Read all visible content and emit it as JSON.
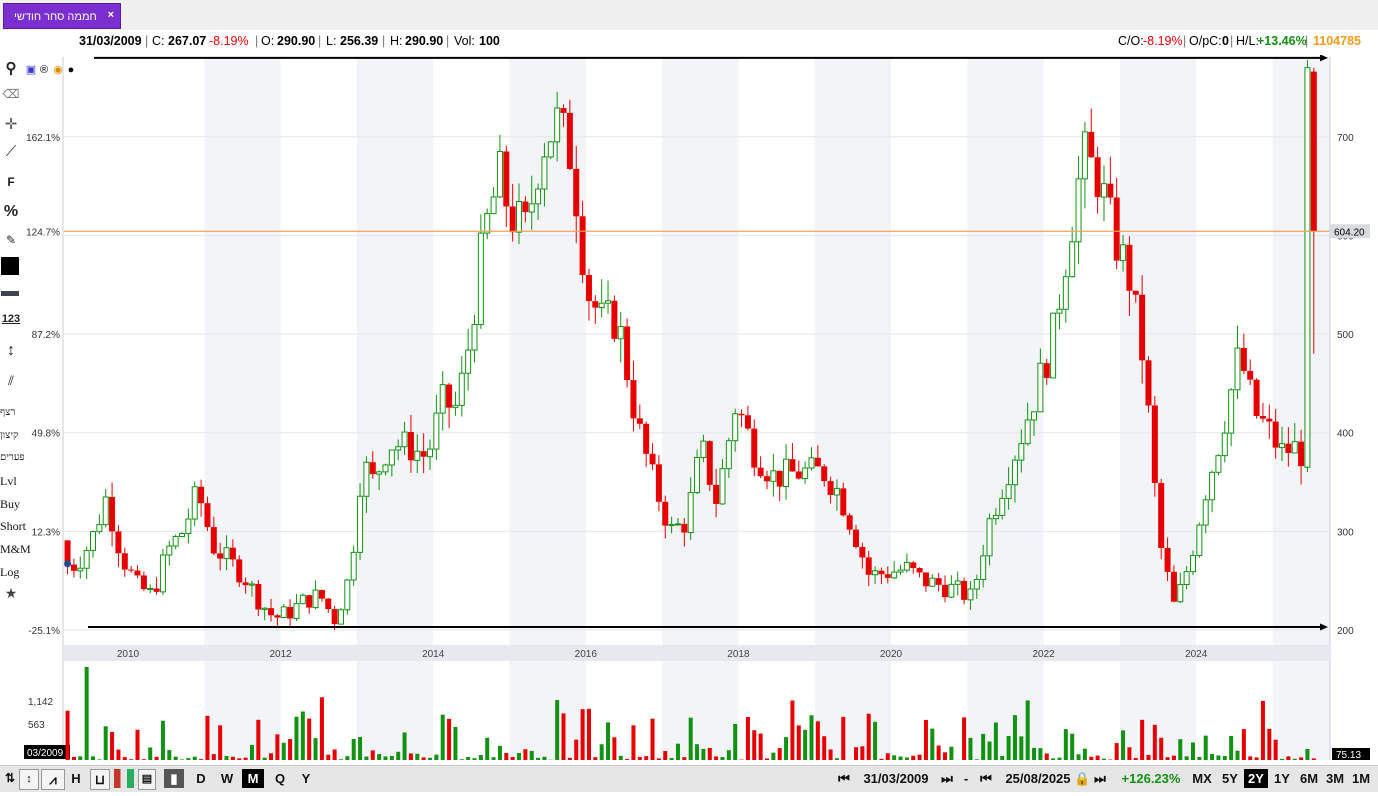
{
  "tab": {
    "label": "חממה סחר חודשי",
    "close": "×"
  },
  "info": {
    "date": "31/03/2009",
    "close_label": "C:",
    "close_value": "267.07",
    "change_pct": "-8.19%",
    "open_label": "O:",
    "open_value": "290.90",
    "low_label": "L:",
    "low_value": "256.39",
    "high_label": "H:",
    "high_value": "290.90",
    "vol_label": "Vol:",
    "vol_value": "100",
    "co_label": "C/O:",
    "co_value": "-8.19%",
    "opc_label": "O/pC:",
    "opc_value": "0",
    "hl_label": "H/L:",
    "hl_value": "+13.46%",
    "id_value": "1104785"
  },
  "left_toolbar": {
    "items_text": [
      "F",
      "%",
      "123"
    ],
    "hebrew_items": [
      "רצף",
      "קיצון",
      "פערים"
    ],
    "labels": [
      "Lvl",
      "Buy",
      "Short",
      "M&M",
      "Log"
    ]
  },
  "bottom": {
    "chart_types": [
      "D",
      "W",
      "M",
      "Q",
      "Y"
    ],
    "selected_type": "M",
    "start_date": "31/03/2009",
    "end_date": "25/08/2025",
    "range_change": "+126.23%",
    "ranges": [
      "MX",
      "5Y",
      "2Y",
      "1Y",
      "6M",
      "3M",
      "1M"
    ],
    "selected_range": "2Y",
    "dash": "-",
    "h_label": "H"
  },
  "colors": {
    "up": "#129212",
    "down": "#e60000",
    "accent": "#7b2fd0",
    "hline": "#f2a35c"
  },
  "chart_data": {
    "type": "candlestick",
    "price_axis": {
      "min": 200,
      "max": 780,
      "ticks": [
        200,
        300,
        400,
        500,
        600,
        700
      ]
    },
    "pct_axis": {
      "labels": [
        "162.1%",
        "124.7%",
        "87.2%",
        "49.8%",
        "12.3%",
        "-25.1%"
      ],
      "values": [
        700,
        604.2,
        500,
        400,
        300,
        200
      ]
    },
    "x_axis": {
      "labels": [
        "2010",
        "2012",
        "2014",
        "2016",
        "2018",
        "2020",
        "2022",
        "2024"
      ],
      "start": 2009.2,
      "end": 2025.65
    },
    "last_price_label": "604.20",
    "horizontal_line": 604.2,
    "top_line": 780,
    "bottom_line": 203,
    "volume_axis": {
      "labels": [
        "1,142",
        "563"
      ],
      "max": 1560
    },
    "volume_left_label": "03/2009",
    "volume_right_label": "75.13",
    "anchors": [
      [
        2009.2,
        267
      ],
      [
        2009.4,
        266
      ],
      [
        2009.6,
        290
      ],
      [
        2009.8,
        335
      ],
      [
        2010.0,
        275
      ],
      [
        2010.2,
        245
      ],
      [
        2010.4,
        235
      ],
      [
        2010.6,
        280
      ],
      [
        2010.8,
        300
      ],
      [
        2011.0,
        340
      ],
      [
        2011.2,
        285
      ],
      [
        2011.4,
        270
      ],
      [
        2011.6,
        255
      ],
      [
        2011.8,
        230
      ],
      [
        2012.0,
        212
      ],
      [
        2012.2,
        218
      ],
      [
        2012.4,
        230
      ],
      [
        2012.6,
        235
      ],
      [
        2012.8,
        210
      ],
      [
        2013.0,
        258
      ],
      [
        2013.15,
        370
      ],
      [
        2013.3,
        350
      ],
      [
        2013.5,
        390
      ],
      [
        2013.8,
        385
      ],
      [
        2014.0,
        375
      ],
      [
        2014.2,
        430
      ],
      [
        2014.4,
        425
      ],
      [
        2014.55,
        490
      ],
      [
        2014.75,
        600
      ],
      [
        2014.95,
        660
      ],
      [
        2015.1,
        620
      ],
      [
        2015.3,
        605
      ],
      [
        2015.5,
        690
      ],
      [
        2015.7,
        715
      ],
      [
        2015.9,
        680
      ],
      [
        2016.1,
        545
      ],
      [
        2016.3,
        512
      ],
      [
        2016.5,
        515
      ],
      [
        2016.75,
        410
      ],
      [
        2016.95,
        355
      ],
      [
        2017.2,
        300
      ],
      [
        2017.4,
        310
      ],
      [
        2017.6,
        385
      ],
      [
        2017.8,
        330
      ],
      [
        2018.05,
        430
      ],
      [
        2018.3,
        380
      ],
      [
        2018.55,
        355
      ],
      [
        2018.9,
        360
      ],
      [
        2019.2,
        360
      ],
      [
        2019.4,
        340
      ],
      [
        2019.6,
        300
      ],
      [
        2019.8,
        255
      ],
      [
        2020.0,
        258
      ],
      [
        2020.3,
        262
      ],
      [
        2020.5,
        250
      ],
      [
        2020.75,
        245
      ],
      [
        2020.95,
        240
      ],
      [
        2021.15,
        232
      ],
      [
        2021.35,
        305
      ],
      [
        2021.55,
        348
      ],
      [
        2021.8,
        400
      ],
      [
        2022.0,
        445
      ],
      [
        2022.2,
        495
      ],
      [
        2022.4,
        590
      ],
      [
        2022.6,
        680
      ],
      [
        2022.8,
        660
      ],
      [
        2023.0,
        600
      ],
      [
        2023.2,
        560
      ],
      [
        2023.4,
        470
      ],
      [
        2023.6,
        290
      ],
      [
        2023.8,
        222
      ],
      [
        2024.0,
        270
      ],
      [
        2024.2,
        340
      ],
      [
        2024.4,
        395
      ],
      [
        2024.65,
        480
      ],
      [
        2024.85,
        420
      ],
      [
        2025.05,
        400
      ],
      [
        2025.2,
        380
      ],
      [
        2025.35,
        385
      ],
      [
        2025.5,
        378
      ],
      [
        2025.6,
        365
      ]
    ],
    "override_last": [
      {
        "o": 365,
        "c": 770,
        "h": 778,
        "l": 360
      },
      {
        "o": 766,
        "c": 604.2,
        "h": 770,
        "l": 480
      }
    ]
  }
}
